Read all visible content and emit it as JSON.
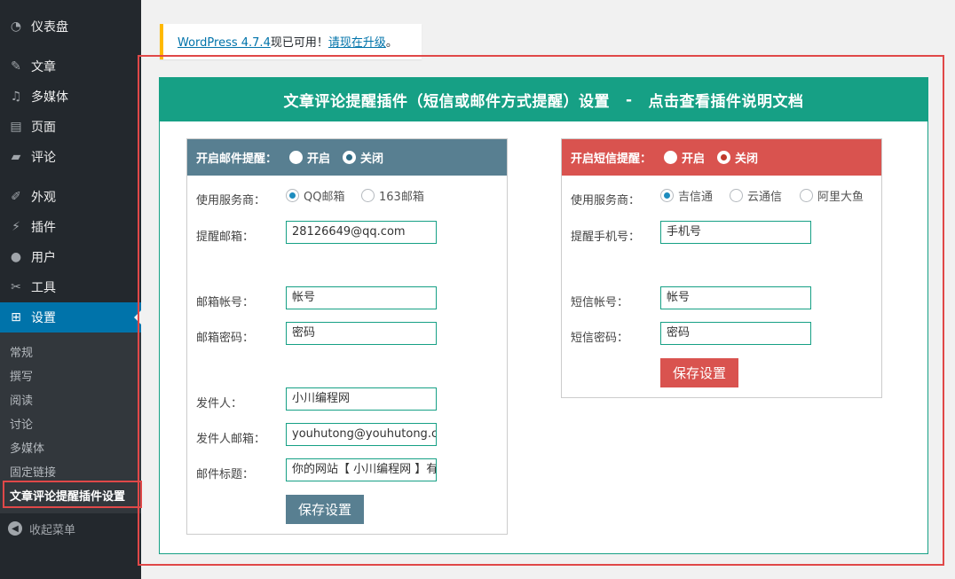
{
  "sidebar": {
    "items": [
      {
        "label": "仪表盘",
        "icon": "dashboard-icon",
        "glyph": "◔"
      },
      {
        "label": "文章",
        "icon": "pin-icon",
        "glyph": "✎"
      },
      {
        "label": "多媒体",
        "icon": "media-icon",
        "glyph": "♫"
      },
      {
        "label": "页面",
        "icon": "page-icon",
        "glyph": "▤"
      },
      {
        "label": "评论",
        "icon": "comment-icon",
        "glyph": "▰"
      },
      {
        "label": "外观",
        "icon": "appearance-icon",
        "glyph": "✐"
      },
      {
        "label": "插件",
        "icon": "plugin-icon",
        "glyph": "⚡"
      },
      {
        "label": "用户",
        "icon": "user-icon",
        "glyph": "●"
      },
      {
        "label": "工具",
        "icon": "wrench-icon",
        "glyph": "✂"
      },
      {
        "label": "设置",
        "icon": "settings-icon",
        "glyph": "⊞"
      }
    ],
    "submenu": [
      "常规",
      "撰写",
      "阅读",
      "讨论",
      "多媒体",
      "固定链接",
      "文章评论提醒插件设置"
    ],
    "collapse_label": "收起菜单"
  },
  "notice": {
    "version_link": "WordPress 4.7.4",
    "text": "现已可用！",
    "update_link": "请现在升级",
    "end": "。"
  },
  "panel": {
    "title": "文章评论提醒插件（短信或邮件方式提醒）设置",
    "separator": "-",
    "doc_link": "点击查看插件说明文档"
  },
  "email_box": {
    "header": "开启邮件提醒：",
    "on_label": "开启",
    "off_label": "关闭",
    "provider_label": "使用服务商：",
    "provider_options": [
      "QQ邮箱",
      "163邮箱"
    ],
    "notify_label": "提醒邮箱：",
    "notify_value": "28126649@qq.com",
    "account_label": "邮箱帐号：",
    "account_value": "帐号",
    "password_label": "邮箱密码：",
    "password_value": "密码",
    "sender_label": "发件人：",
    "sender_value": "小川编程网",
    "sender_email_label": "发件人邮箱：",
    "sender_email_value": "youhutong@youhutong.com",
    "subject_label": "邮件标题：",
    "subject_value": "你的网站【 小川编程网 】有新评论",
    "save_label": "保存设置",
    "color": "#587f91"
  },
  "sms_box": {
    "header": "开启短信提醒：",
    "on_label": "开启",
    "off_label": "关闭",
    "provider_label": "使用服务商：",
    "provider_options": [
      "吉信通",
      "云通信",
      "阿里大鱼"
    ],
    "phone_label": "提醒手机号：",
    "phone_value": "手机号",
    "account_label": "短信帐号：",
    "account_value": "帐号",
    "password_label": "短信密码：",
    "password_value": "密码",
    "save_label": "保存设置",
    "color": "#d9534f"
  },
  "colors": {
    "accent": "#16a085",
    "highlight": "#e04848",
    "active_menu": "#0073aa"
  }
}
